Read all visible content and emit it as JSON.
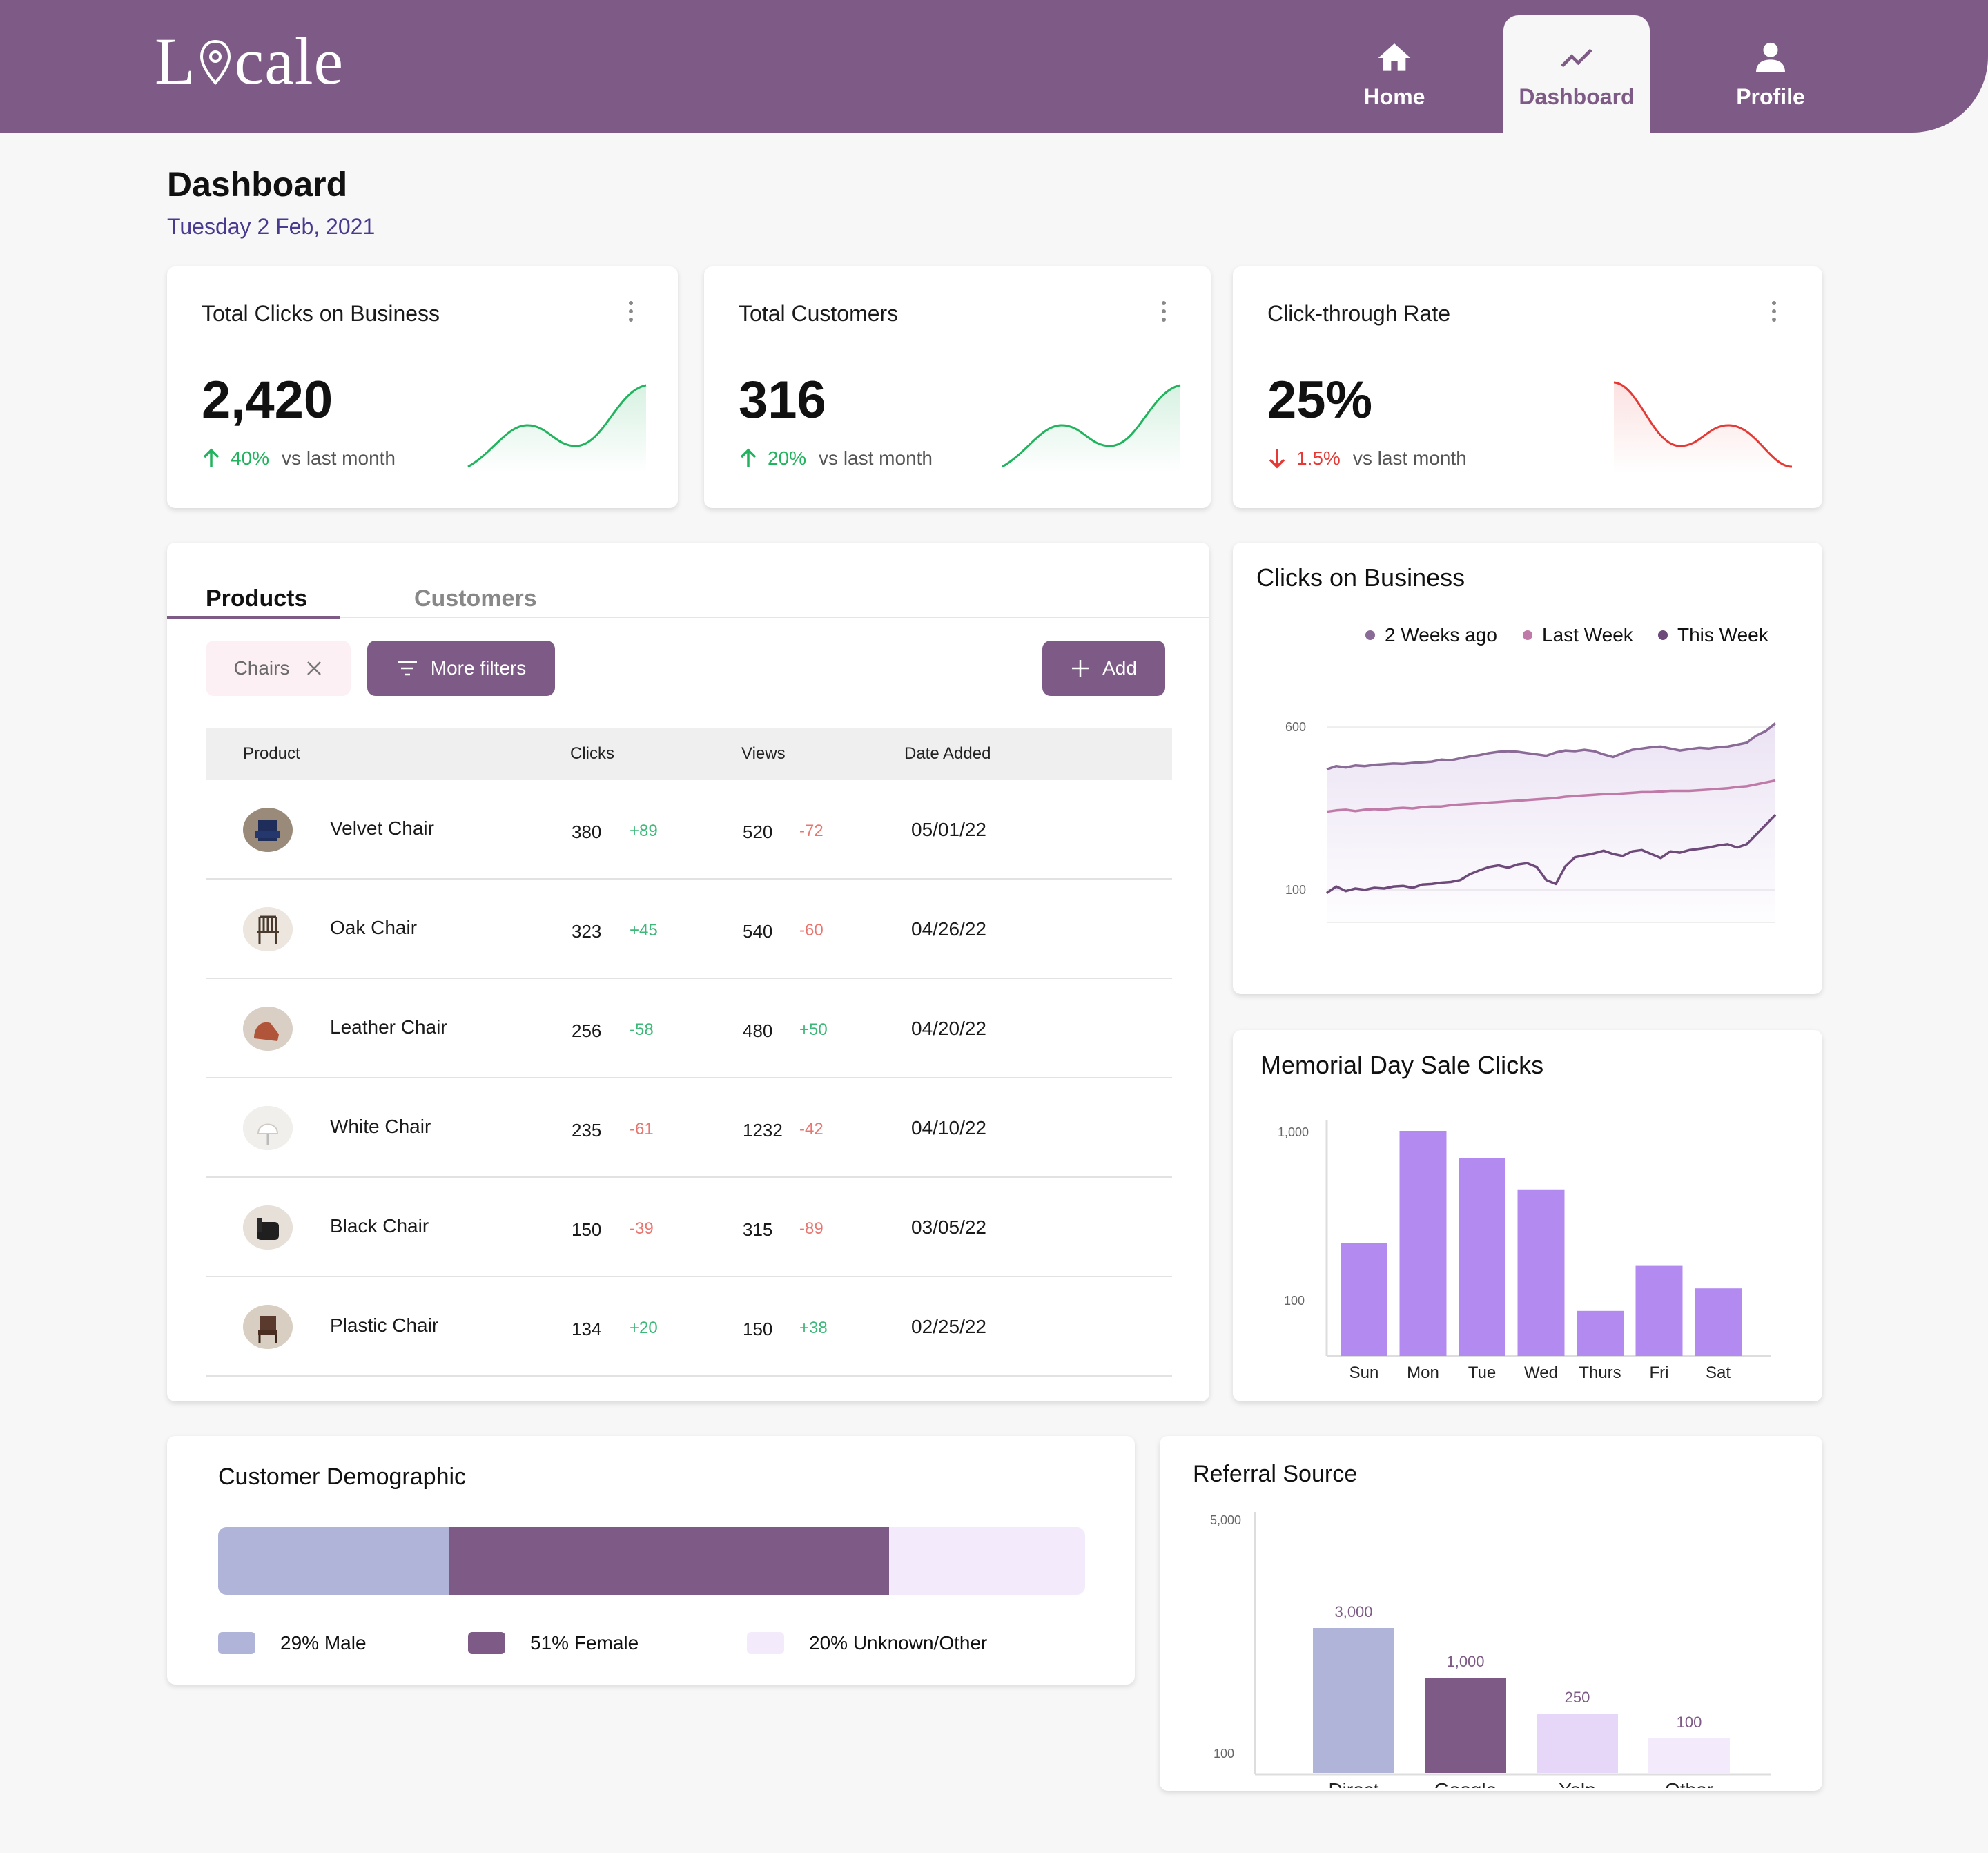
{
  "header": {
    "brand_pre": "L",
    "brand_post": "cale",
    "nav": [
      {
        "label": "Home",
        "icon": "home-icon"
      },
      {
        "label": "Dashboard",
        "icon": "trend-icon"
      },
      {
        "label": "Profile",
        "icon": "person-icon"
      }
    ],
    "active_tab": "Dashboard"
  },
  "page": {
    "title": "Dashboard",
    "date": "Tuesday 2 Feb, 2021"
  },
  "colors": {
    "brand": "#7e5b86",
    "positive": "#22b35e",
    "negative": "#e53935",
    "bar_purple": "#b38bf0",
    "male": "#b0b4d8",
    "female": "#7e5b86",
    "unknown": "#f3ebfb"
  },
  "kpis": [
    {
      "title": "Total Clicks on Business",
      "value": "2,420",
      "change": "40%",
      "direction": "up",
      "vs": "vs last month"
    },
    {
      "title": "Total Customers",
      "value": "316",
      "change": "20%",
      "direction": "up",
      "vs": "vs last month"
    },
    {
      "title": "Click-through Rate",
      "value": "25%",
      "change": "1.5%",
      "direction": "down",
      "vs": "vs last month"
    }
  ],
  "products_panel": {
    "tabs": [
      "Products",
      "Customers"
    ],
    "active_tab": "Products",
    "filter_chip": "Chairs",
    "more_filters": "More filters",
    "add": "Add",
    "columns": [
      "Product",
      "Clicks",
      "Views",
      "Date Added"
    ],
    "rows": [
      {
        "name": "Velvet Chair",
        "clicks": "380",
        "clicks_delta": "+89",
        "views": "520",
        "views_delta": "-72",
        "date": "05/01/22"
      },
      {
        "name": "Oak Chair",
        "clicks": "323",
        "clicks_delta": "+45",
        "views": "540",
        "views_delta": "-60",
        "date": "04/26/22"
      },
      {
        "name": "Leather Chair",
        "clicks": "256",
        "clicks_delta": "-58",
        "views": "480",
        "views_delta": "+50",
        "date": "04/20/22"
      },
      {
        "name": "White Chair",
        "clicks": "235",
        "clicks_delta": "-61",
        "views": "1232",
        "views_delta": "-42",
        "date": "04/10/22"
      },
      {
        "name": "Black Chair",
        "clicks": "150",
        "clicks_delta": "-39",
        "views": "315",
        "views_delta": "-89",
        "date": "03/05/22"
      },
      {
        "name": "Plastic Chair",
        "clicks": "134",
        "clicks_delta": "+20",
        "views": "150",
        "views_delta": "+38",
        "date": "02/25/22"
      }
    ]
  },
  "clicks_panel": {
    "title": "Clicks on Business"
  },
  "memorial_panel": {
    "title": "Memorial Day Sale Clicks"
  },
  "demographic": {
    "title": "Customer Demographic",
    "segments": [
      {
        "label": "29% Male",
        "value": 29
      },
      {
        "label": "51% Female",
        "value": 51
      },
      {
        "label": "20% Unknown/Other",
        "value": 20
      }
    ]
  },
  "referral_panel": {
    "title": "Referral Source"
  },
  "chart_data": [
    {
      "type": "line",
      "title": "Clicks on Business",
      "y_ticks": [
        "600",
        "100"
      ],
      "ylim": [
        0,
        700
      ],
      "grid": true,
      "legend_placement": "top-right",
      "series": [
        {
          "name": "2 Weeks ago",
          "color": "#8a6a96",
          "values": [
            470,
            480,
            476,
            482,
            480,
            484,
            486,
            488,
            487,
            490,
            492,
            494,
            500,
            498,
            504,
            510,
            514,
            520,
            524,
            526,
            524,
            520,
            516,
            512,
            522,
            528,
            526,
            530,
            526,
            516,
            508,
            520,
            530,
            534,
            538,
            540,
            534,
            528,
            532,
            536,
            534,
            538,
            540,
            546,
            552,
            574,
            588,
            612
          ]
        },
        {
          "name": "Last Week",
          "color": "#c07aa8",
          "values": [
            340,
            344,
            346,
            342,
            346,
            348,
            346,
            350,
            352,
            350,
            354,
            356,
            356,
            360,
            362,
            364,
            366,
            368,
            370,
            372,
            374,
            376,
            378,
            380,
            382,
            386,
            388,
            390,
            392,
            394,
            394,
            396,
            398,
            400,
            400,
            402,
            404,
            404,
            404,
            406,
            408,
            410,
            412,
            416,
            418,
            424,
            430,
            436
          ]
        },
        {
          "name": "This Week",
          "color": "#6e4a7a",
          "values": [
            90,
            110,
            96,
            104,
            100,
            106,
            104,
            110,
            112,
            106,
            116,
            118,
            122,
            124,
            130,
            148,
            160,
            170,
            175,
            168,
            178,
            182,
            170,
            130,
            118,
            172,
            200,
            206,
            212,
            220,
            210,
            204,
            218,
            222,
            210,
            198,
            218,
            214,
            222,
            226,
            230,
            236,
            240,
            230,
            240,
            270,
            300,
            330
          ]
        }
      ]
    },
    {
      "type": "bar",
      "title": "Memorial Day Sale Clicks",
      "categories": [
        "Sun",
        "Mon",
        "Tue",
        "Wed",
        "Thurs",
        "Fri",
        "Sat"
      ],
      "values": [
        500,
        1000,
        880,
        740,
        200,
        400,
        300
      ],
      "y_ticks": [
        "1,000",
        "100"
      ],
      "ylim": [
        0,
        1000
      ]
    },
    {
      "type": "bar",
      "title": "Referral Source",
      "categories": [
        "Direct",
        "Google",
        "Yelp",
        "Other"
      ],
      "values": [
        3000,
        1000,
        250,
        100
      ],
      "value_labels": [
        "3,000",
        "1,000",
        "250",
        "100"
      ],
      "y_ticks": [
        "5,000",
        "100"
      ],
      "colors": [
        "#b0b4d8",
        "#7e5b86",
        "#e6d6f7",
        "#f3ebfb"
      ]
    }
  ]
}
